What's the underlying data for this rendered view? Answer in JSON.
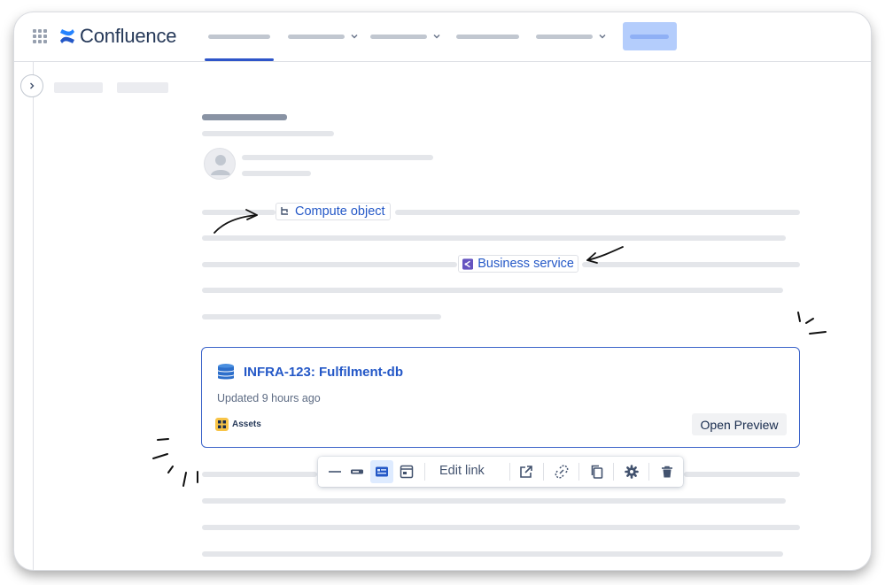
{
  "app": {
    "name": "Confluence"
  },
  "colors": {
    "brand": "#2458c7",
    "accent": "#2e55c9",
    "create_button": "#b4cdfc",
    "card_border": "#3b63c9",
    "assets_icon": "#f8c447",
    "business_service_icon": "#6554c0"
  },
  "header": {
    "icons": {
      "app_switcher": "grid-icon",
      "logo": "confluence-logo-icon"
    },
    "nav_items": [
      {
        "has_dropdown": false,
        "active": true
      },
      {
        "has_dropdown": true,
        "active": false
      },
      {
        "has_dropdown": true,
        "active": false
      },
      {
        "has_dropdown": false,
        "active": false
      },
      {
        "has_dropdown": true,
        "active": false
      }
    ]
  },
  "content": {
    "inline_links": [
      {
        "label": "Compute object",
        "icon": "compute-object-icon"
      },
      {
        "label": "Business service",
        "icon": "business-service-icon"
      }
    ],
    "card": {
      "title": "INFRA-123: Fulfilment-db",
      "updated": "Updated 9 hours ago",
      "source": "Assets",
      "preview_button": "Open Preview",
      "icon": "database-icon"
    },
    "toolbar": {
      "edit_link": "Edit link",
      "buttons": [
        "inline-view-icon",
        "url-view-icon",
        "card-view-icon",
        "embed-view-icon",
        "open-link-icon",
        "unlink-icon",
        "copy-icon",
        "settings-icon",
        "delete-icon"
      ],
      "selected": "card-view-icon"
    }
  }
}
